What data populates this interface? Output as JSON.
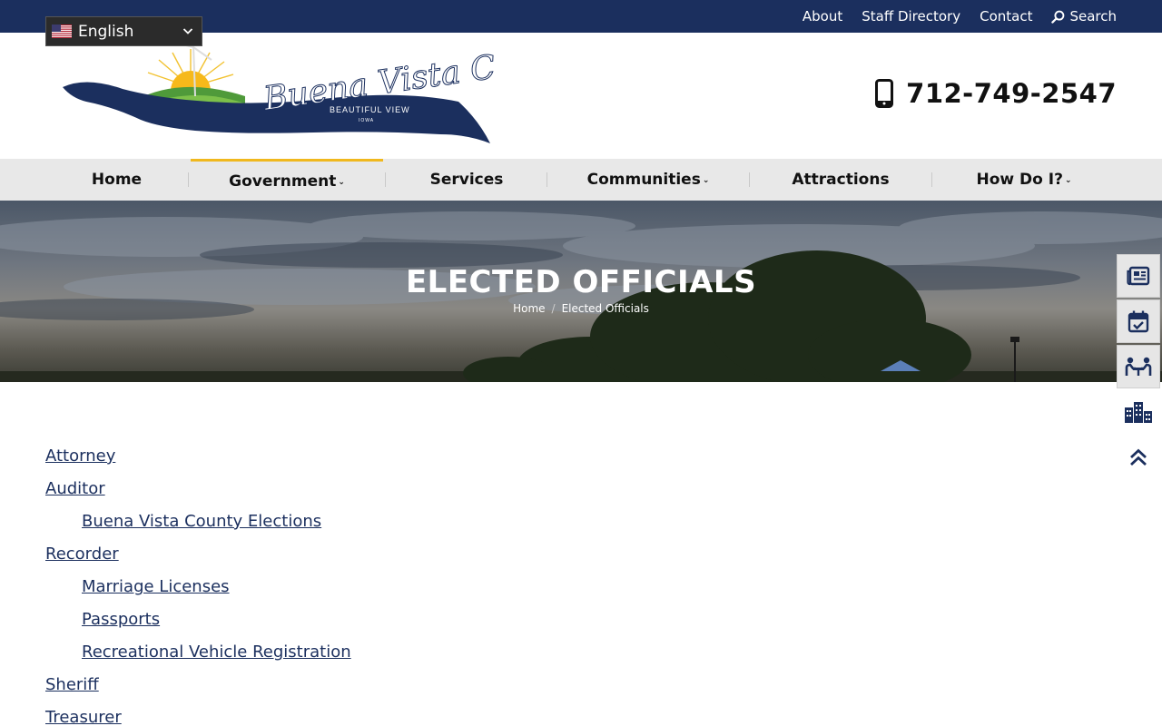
{
  "topbar": {
    "links": [
      "About",
      "Staff Directory",
      "Contact"
    ],
    "search_label": "Search"
  },
  "language": {
    "label": "English",
    "flag": "us-flag-icon"
  },
  "header": {
    "logo_text": "Buena Vista County",
    "logo_tagline": "BEAUTIFUL VIEW",
    "logo_state": "IOWA",
    "phone": "712-749-2547"
  },
  "nav": {
    "items": [
      {
        "label": "Home",
        "has_caret": false
      },
      {
        "label": "Government",
        "has_caret": true,
        "active": true
      },
      {
        "label": "Services",
        "has_caret": false
      },
      {
        "label": "Communities",
        "has_caret": true
      },
      {
        "label": "Attractions",
        "has_caret": false
      },
      {
        "label": "How Do I?",
        "has_caret": true
      }
    ],
    "caret_glyph": "⌄"
  },
  "hero": {
    "title": "ELECTED OFFICIALS",
    "breadcrumb": [
      "Home",
      "Elected Officials"
    ],
    "breadcrumb_sep": "/"
  },
  "sidetools": [
    "news-icon",
    "calendar-icon",
    "meeting-icon",
    "buildings-icon",
    "scroll-top-icon"
  ],
  "content": {
    "links": [
      {
        "label": "Attorney",
        "level": 0
      },
      {
        "label": "Auditor",
        "level": 0
      },
      {
        "label": "Buena Vista County Elections",
        "level": 1
      },
      {
        "label": "Recorder",
        "level": 0
      },
      {
        "label": "Marriage Licenses",
        "level": 1
      },
      {
        "label": "Passports",
        "level": 1
      },
      {
        "label": "Recreational Vehicle Registration",
        "level": 1
      },
      {
        "label": "Sheriff",
        "level": 0
      },
      {
        "label": "Treasurer",
        "level": 0
      }
    ]
  },
  "colors": {
    "navy": "#1b2f5e",
    "accent": "#f0b81e",
    "nav_bg": "#e8e8e8"
  }
}
